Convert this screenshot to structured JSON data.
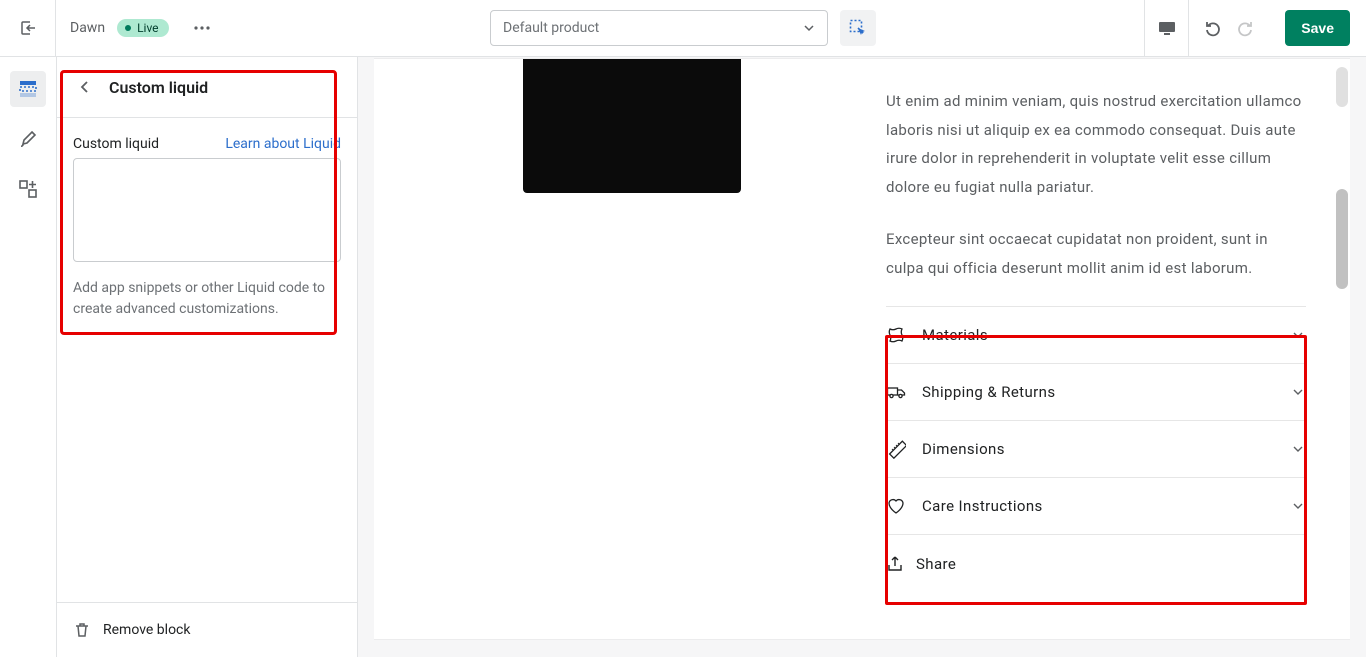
{
  "topbar": {
    "theme_name": "Dawn",
    "live_label": "Live",
    "template_label": "Default product",
    "save_label": "Save"
  },
  "sidebar": {
    "title": "Custom liquid",
    "field_label": "Custom liquid",
    "help_link": "Learn about Liquid",
    "textarea_value": "",
    "help_text": "Add app snippets or other Liquid code to create advanced customizations.",
    "remove_label": "Remove block"
  },
  "preview": {
    "paragraph1": "Ut enim ad minim veniam, quis nostrud exercitation ullamco laboris nisi ut aliquip ex ea commodo consequat. Duis aute irure dolor in reprehenderit in voluptate velit esse cillum dolore eu fugiat nulla pariatur.",
    "paragraph2": "Excepteur sint occaecat cupidatat non proident, sunt in culpa qui officia deserunt mollit anim id est laborum.",
    "accordions": {
      "materials": "Materials",
      "shipping": "Shipping & Returns",
      "dimensions": "Dimensions",
      "care": "Care Instructions"
    },
    "share_label": "Share"
  }
}
